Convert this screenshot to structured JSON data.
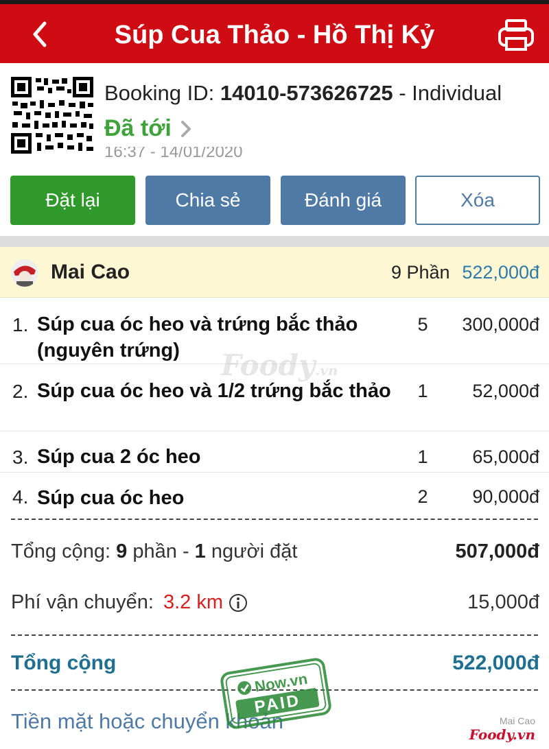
{
  "header": {
    "title": "Súp Cua Thảo - Hồ Thị Kỷ",
    "back_icon": "back-arrow-icon",
    "print_icon": "printer-icon"
  },
  "booking": {
    "id_label": "Booking ID:",
    "id_value": "14010-573626725",
    "id_suffix": "- Individual",
    "status": "Đã tới",
    "time": "16:37 - 14/01/2020"
  },
  "actions": {
    "reorder": "Đặt lại",
    "share": "Chia sẻ",
    "rate": "Đánh giá",
    "delete": "Xóa"
  },
  "user": {
    "name": "Mai Cao",
    "portions": "9 Phần",
    "total": "522,000đ"
  },
  "items": [
    {
      "num": "1.",
      "name": "Súp cua óc heo và trứng bắc thảo (nguyên trứng)",
      "qty": "5",
      "price": "300,000đ"
    },
    {
      "num": "2.",
      "name": "Súp cua óc heo và 1/2 trứng bắc thảo",
      "qty": "1",
      "price": "52,000đ"
    },
    {
      "num": "3.",
      "name": "Súp cua 2 óc heo",
      "qty": "1",
      "price": "65,000đ"
    },
    {
      "num": "4.",
      "name": "Súp cua óc heo",
      "qty": "2",
      "price": "90,000đ"
    }
  ],
  "summary": {
    "subtotal_label": "Tổng cộng:",
    "subtotal_count": "9",
    "subtotal_unit": "phần -",
    "subtotal_people": "1",
    "subtotal_people_label": "người đặt",
    "subtotal_value": "507,000đ",
    "shipping_label": "Phí vận chuyển:",
    "shipping_distance": "3.2 km",
    "shipping_value": "15,000đ",
    "grand_label": "Tổng cộng",
    "grand_value": "522,000đ"
  },
  "payment_method": "Tiền mặt hoặc chuyển khoản",
  "stamp": {
    "brand": "Now.vn",
    "text": "PAID"
  },
  "watermark": {
    "brand": "Foody",
    "suffix": ".vn"
  },
  "corner_brand": {
    "user": "Mai Cao",
    "brand": "Foody.vn"
  },
  "colors": {
    "header_bg": "#cf0c14",
    "status_green": "#3ea33a",
    "reorder_bg": "#2f9a2b",
    "action_blue": "#4f7aa6",
    "grand_total": "#1f6f90",
    "distance_red": "#d81f1f",
    "user_row_bg": "#fdf7d4"
  }
}
